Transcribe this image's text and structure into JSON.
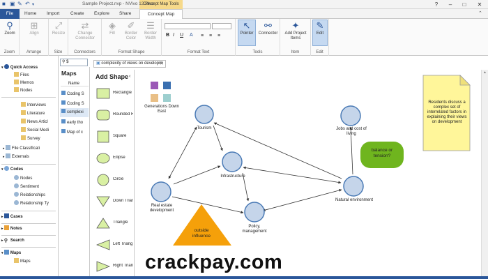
{
  "window": {
    "title": "Sample Project.nvp - NVivo 12 Plus",
    "contextual_group": "Concept Map Tools",
    "controls": [
      "?",
      "–",
      "□",
      "✕"
    ]
  },
  "tabs": [
    "File",
    "Home",
    "Import",
    "Create",
    "Explore",
    "Share",
    "Concept Map"
  ],
  "ribbon": {
    "groups": [
      {
        "name": "Zoom",
        "buttons": [
          {
            "label": "Zoom",
            "icon": "search-icon"
          }
        ]
      },
      {
        "name": "Arrange",
        "buttons": [
          {
            "label": "Align",
            "icon": "align-icon"
          }
        ]
      },
      {
        "name": "Size",
        "buttons": [
          {
            "label": "Resize",
            "icon": "resize-icon"
          }
        ]
      },
      {
        "name": "Connectors",
        "buttons": [
          {
            "label": "Change Connector",
            "icon": "connector-change-icon"
          }
        ]
      },
      {
        "name": "Format Shape",
        "buttons": [
          {
            "label": "Fill",
            "icon": "fill-bucket-icon"
          },
          {
            "label": "Border Color",
            "icon": "pen-icon"
          },
          {
            "label": "Border Width",
            "icon": "lines-icon"
          }
        ]
      },
      {
        "name": "Format Text",
        "buttons": [
          {
            "label": "B"
          },
          {
            "label": "I"
          },
          {
            "label": "U"
          },
          {
            "label": "A"
          }
        ]
      },
      {
        "name": "Tools",
        "buttons": [
          {
            "label": "Pointer",
            "icon": "pointer-icon"
          },
          {
            "label": "Connector",
            "icon": "connector-icon"
          }
        ]
      },
      {
        "name": "Item",
        "buttons": [
          {
            "label": "Add Project Items",
            "icon": "sparkle-icon"
          }
        ]
      },
      {
        "name": "Edit",
        "buttons": [
          {
            "label": "Edit",
            "icon": "pencil-icon"
          }
        ]
      }
    ]
  },
  "navigation": {
    "sections": [
      {
        "label": "Quick Access",
        "items": [
          "Files",
          "Memos",
          "Nodes"
        ]
      },
      {
        "label": "",
        "items": [
          "Interviews",
          "Literature",
          "News Articl",
          "Social Medi",
          "Survey"
        ]
      },
      {
        "label": "",
        "items": [
          "File Classificati",
          "Externals"
        ]
      },
      {
        "label": "Codes",
        "items": [
          "Nodes",
          "Sentiment",
          "Relationships",
          "Relationship Ty"
        ]
      },
      {
        "label": "Cases",
        "items": []
      },
      {
        "label": "Notes",
        "items": []
      },
      {
        "label": "Search",
        "items": []
      },
      {
        "label": "Maps",
        "items": [
          "Maps"
        ]
      }
    ]
  },
  "maps_pane": {
    "search": "$",
    "title": "Maps",
    "column": "Name",
    "items": [
      "Coding S",
      "Coding S",
      "complexi",
      "early tho",
      "Map of c"
    ]
  },
  "document_tab": "complexity of views on developm",
  "add_shape": {
    "title": "Add Shape",
    "shapes": [
      "Rectangle",
      "Rounded R",
      "Square",
      "Ellipse",
      "Circle",
      "Down Trian",
      "Triangle",
      "Left Triang",
      "Right Trian"
    ]
  },
  "concept_map": {
    "legend_label": "Generations Down East",
    "nodes": [
      "Tourism",
      "Jobs and cost of living",
      "Infrastructure",
      "Real estate development",
      "Natural environment",
      "Policy, management"
    ],
    "callout_green": "balance or tension?",
    "callout_orange": "outside influence",
    "note": "Residents discuss a complex set of interrelated factors in explaining their views on development"
  },
  "watermark": "crackpay.com",
  "colors": {
    "accent": "#2b579a",
    "node_fill": "#c5d5ea",
    "node_stroke": "#4a7ab5",
    "green": "#6fb51e",
    "orange": "#f5a00a",
    "note": "#fff69a",
    "contextual": "#f6d98a"
  }
}
